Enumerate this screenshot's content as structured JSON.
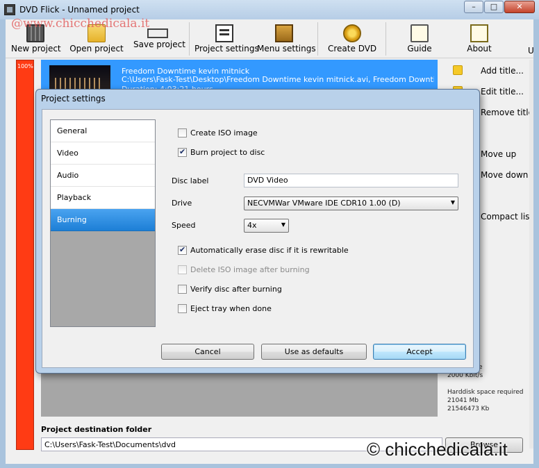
{
  "window": {
    "title": "DVD Flick - Unnamed project",
    "watermark_top": "@www.chicchedicala.it",
    "min_glyph": "–",
    "max_glyph": "□",
    "close_glyph": "✕"
  },
  "toolbar": {
    "items": [
      {
        "label": "New project",
        "icon": "film-icon"
      },
      {
        "label": "Open project",
        "icon": "folder-icon"
      },
      {
        "label": "Save project",
        "icon": "save-icon"
      },
      {
        "label": "Project settings",
        "icon": "settings-icon"
      },
      {
        "label": "Menu settings",
        "icon": "menu-icon"
      },
      {
        "label": "Create DVD",
        "icon": "gears-icon"
      },
      {
        "label": "Guide",
        "icon": "guide-icon"
      },
      {
        "label": "About",
        "icon": "about-icon"
      }
    ],
    "update_fragment": "U"
  },
  "progress": {
    "label": "100%"
  },
  "titles": {
    "item": {
      "name": "Freedom Downtime kevin mitnick",
      "path": "C:\\Users\\Fask-Test\\Desktop\\Freedom Downtime kevin mitnick.avi, Freedom Downtime kevin mitnick",
      "duration": "Duration: 4:03:21 hours"
    }
  },
  "right_actions": {
    "add_title": "Add title...",
    "edit_title": "Edit title...",
    "remove_title": "Remove title",
    "move_up": "Move up",
    "move_down": "Move down",
    "compact_list": "Compact list"
  },
  "info": {
    "frag1": "on",
    "frag2": "rs",
    "frag3": "ate",
    "bitrate": "2000 Kbit/s",
    "hdd_label": "Harddisk space required",
    "hdd_mb": "21041 Mb",
    "hdd_kb": "21546473 Kb"
  },
  "destination": {
    "label": "Project destination folder",
    "value": "C:\\Users\\Fask-Test\\Documents\\dvd",
    "browse": "Browse"
  },
  "watermark_bottom": "© chicchedicala.it",
  "dialog": {
    "title": "Project settings",
    "nav": [
      "General",
      "Video",
      "Audio",
      "Playback",
      "Burning"
    ],
    "selected_nav": "Burning",
    "create_iso": {
      "label": "Create ISO image",
      "checked": false
    },
    "burn_to_disc": {
      "label": "Burn project to disc",
      "checked": true
    },
    "disc_label": {
      "label": "Disc label",
      "value": "DVD Video"
    },
    "drive": {
      "label": "Drive",
      "value": "NECVMWar VMware IDE CDR10 1.00 (D)"
    },
    "speed": {
      "label": "Speed",
      "value": "4x"
    },
    "auto_erase": {
      "label": "Automatically erase disc if it is rewritable",
      "checked": true
    },
    "delete_iso": {
      "label": "Delete ISO image after burning",
      "checked": false,
      "disabled": true
    },
    "verify": {
      "label": "Verify disc after burning",
      "checked": false
    },
    "eject": {
      "label": "Eject tray when done",
      "checked": false
    },
    "buttons": {
      "cancel": "Cancel",
      "defaults": "Use as defaults",
      "accept": "Accept"
    }
  }
}
